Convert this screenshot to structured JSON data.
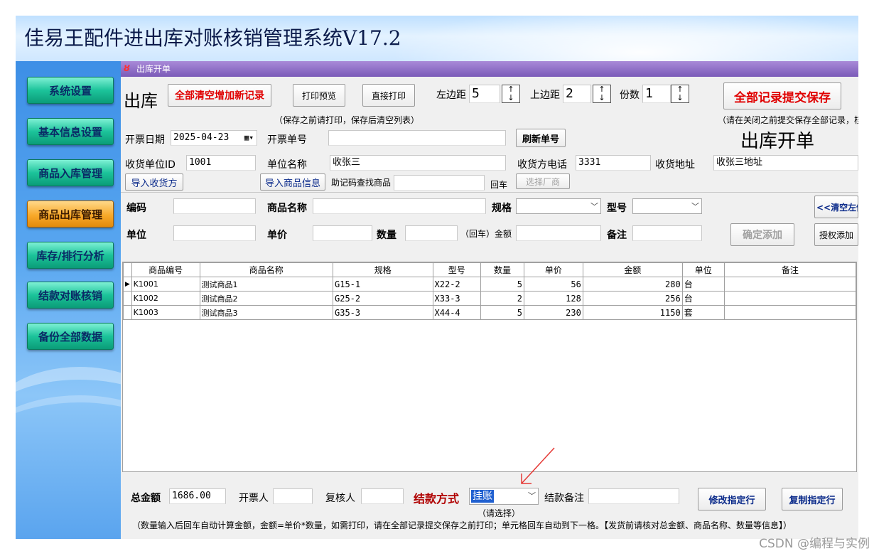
{
  "app": {
    "title": "佳易王配件进出库对账核销管理系统V17.2"
  },
  "sidebar": {
    "items": [
      {
        "label": "系统设置",
        "active": false
      },
      {
        "label": "基本信息设置",
        "active": false
      },
      {
        "label": "商品入库管理",
        "active": false
      },
      {
        "label": "商品出库管理",
        "active": true
      },
      {
        "label": "库存/排行分析",
        "active": false
      },
      {
        "label": "结款对账核销",
        "active": false
      },
      {
        "label": "备份全部数据",
        "active": false
      }
    ]
  },
  "window": {
    "title": "出库开单"
  },
  "toolbar": {
    "heading": "出库",
    "clear_add_label": "全部清空增加新记录",
    "print_preview_label": "打印预览",
    "direct_print_label": "直接打印",
    "left_margin_label": "左边距",
    "left_margin_value": "5",
    "top_margin_label": "上边距",
    "top_margin_value": "2",
    "copies_label": "份数",
    "copies_value": "1",
    "submit_all_label": "全部记录提交保存",
    "note_print": "（保存之前请打印，保存后清空列表）",
    "note_submit": "（请在关闭之前提交保存全部记录，核"
  },
  "form": {
    "date_label": "开票日期",
    "date_value": "2025-04-23",
    "order_no_label": "开票单号",
    "order_no_value": "",
    "refresh_label": "刷新单号",
    "big_title": "出库开单",
    "receiver_id_label": "收货单位ID",
    "receiver_id_value": "1001",
    "unit_name_label": "单位名称",
    "unit_name_value": "收张三",
    "receiver_phone_label": "收货方电话",
    "receiver_phone_value": "3331",
    "receiver_addr_label": "收货地址",
    "receiver_addr_value": "收张三地址",
    "import_receiver_label": "导入收货方",
    "import_goods_label": "导入商品信息",
    "mnemonic_label": "助记码查找商品",
    "enter_label": "回车",
    "select_vendor_label": "选择厂商"
  },
  "entry": {
    "code_label": "编码",
    "name_label": "商品名称",
    "spec_label": "规格",
    "model_label": "型号",
    "clear_left_label": "<<清空左侧",
    "unit_label": "单位",
    "price_label": "单价",
    "qty_label": "数量",
    "enter_amount_label": "（回车）金额",
    "remark_label": "备注",
    "confirm_add_label": "确定添加",
    "auth_add_label": "授权添加"
  },
  "table": {
    "headers": [
      "商品编号",
      "商品名称",
      "规格",
      "型号",
      "数量",
      "单价",
      "金额",
      "单位",
      "备注"
    ],
    "rows": [
      {
        "code": "K1001",
        "name": "测试商品1",
        "spec": "G15-1",
        "model": "X22-2",
        "qty": "5",
        "price": "56",
        "amount": "280",
        "unit": "台",
        "remark": ""
      },
      {
        "code": "K1002",
        "name": "测试商品2",
        "spec": "G25-2",
        "model": "X33-3",
        "qty": "2",
        "price": "128",
        "amount": "256",
        "unit": "台",
        "remark": ""
      },
      {
        "code": "K1003",
        "name": "测试商品3",
        "spec": "G35-3",
        "model": "X44-4",
        "qty": "5",
        "price": "230",
        "amount": "1150",
        "unit": "套",
        "remark": ""
      }
    ]
  },
  "footer": {
    "total_label": "总金额",
    "total_value": "1686.00",
    "issuer_label": "开票人",
    "reviewer_label": "复核人",
    "payment_label": "结款方式",
    "payment_value": "挂账",
    "payment_hint": "（请选择）",
    "payment_remark_label": "结款备注",
    "modify_row_label": "修改指定行",
    "copy_row_label": "复制指定行",
    "note": "（数量输入后回车自动计算金额，金额=单价*数量，如需打印，请在全部记录提交保存之前打印；单元格回车自动到下一格。【发货前请核对总金额、商品名称、数量等信息】）"
  },
  "watermark": "CSDN @编程与实例",
  "colors": {
    "accent_red": "#e00000",
    "title_purple": "#7a5ab8",
    "nav_green": "#1cc39a",
    "nav_active": "#f8a92a",
    "annotation_arrow": "#e53935"
  }
}
